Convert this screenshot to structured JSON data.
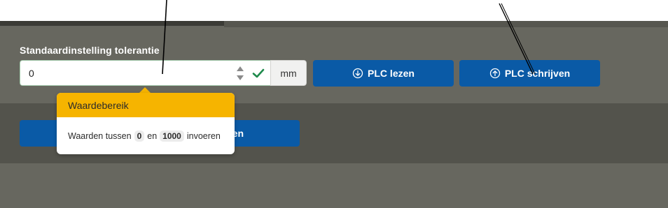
{
  "form": {
    "label": "Standaardinstelling tolerantie",
    "input_value": "0",
    "unit": "mm"
  },
  "buttons": {
    "read_label": "PLC lezen",
    "write_label": "PLC schrijven",
    "lower_visible_label": "en"
  },
  "popover": {
    "title": "Waardebereik",
    "text_before": "Waarden tussen",
    "min": "0",
    "text_mid": "en",
    "max": "1000",
    "text_after": "invoeren"
  },
  "icons": {
    "spinner": "number-spinner-icon",
    "valid": "checkmark-icon",
    "read": "arrow-down-circle-icon",
    "write": "arrow-up-circle-icon"
  },
  "colors": {
    "primary": "#0a5aa6",
    "warning": "#f6b400",
    "valid": "#1f8a4c",
    "panel": "#67675f"
  }
}
